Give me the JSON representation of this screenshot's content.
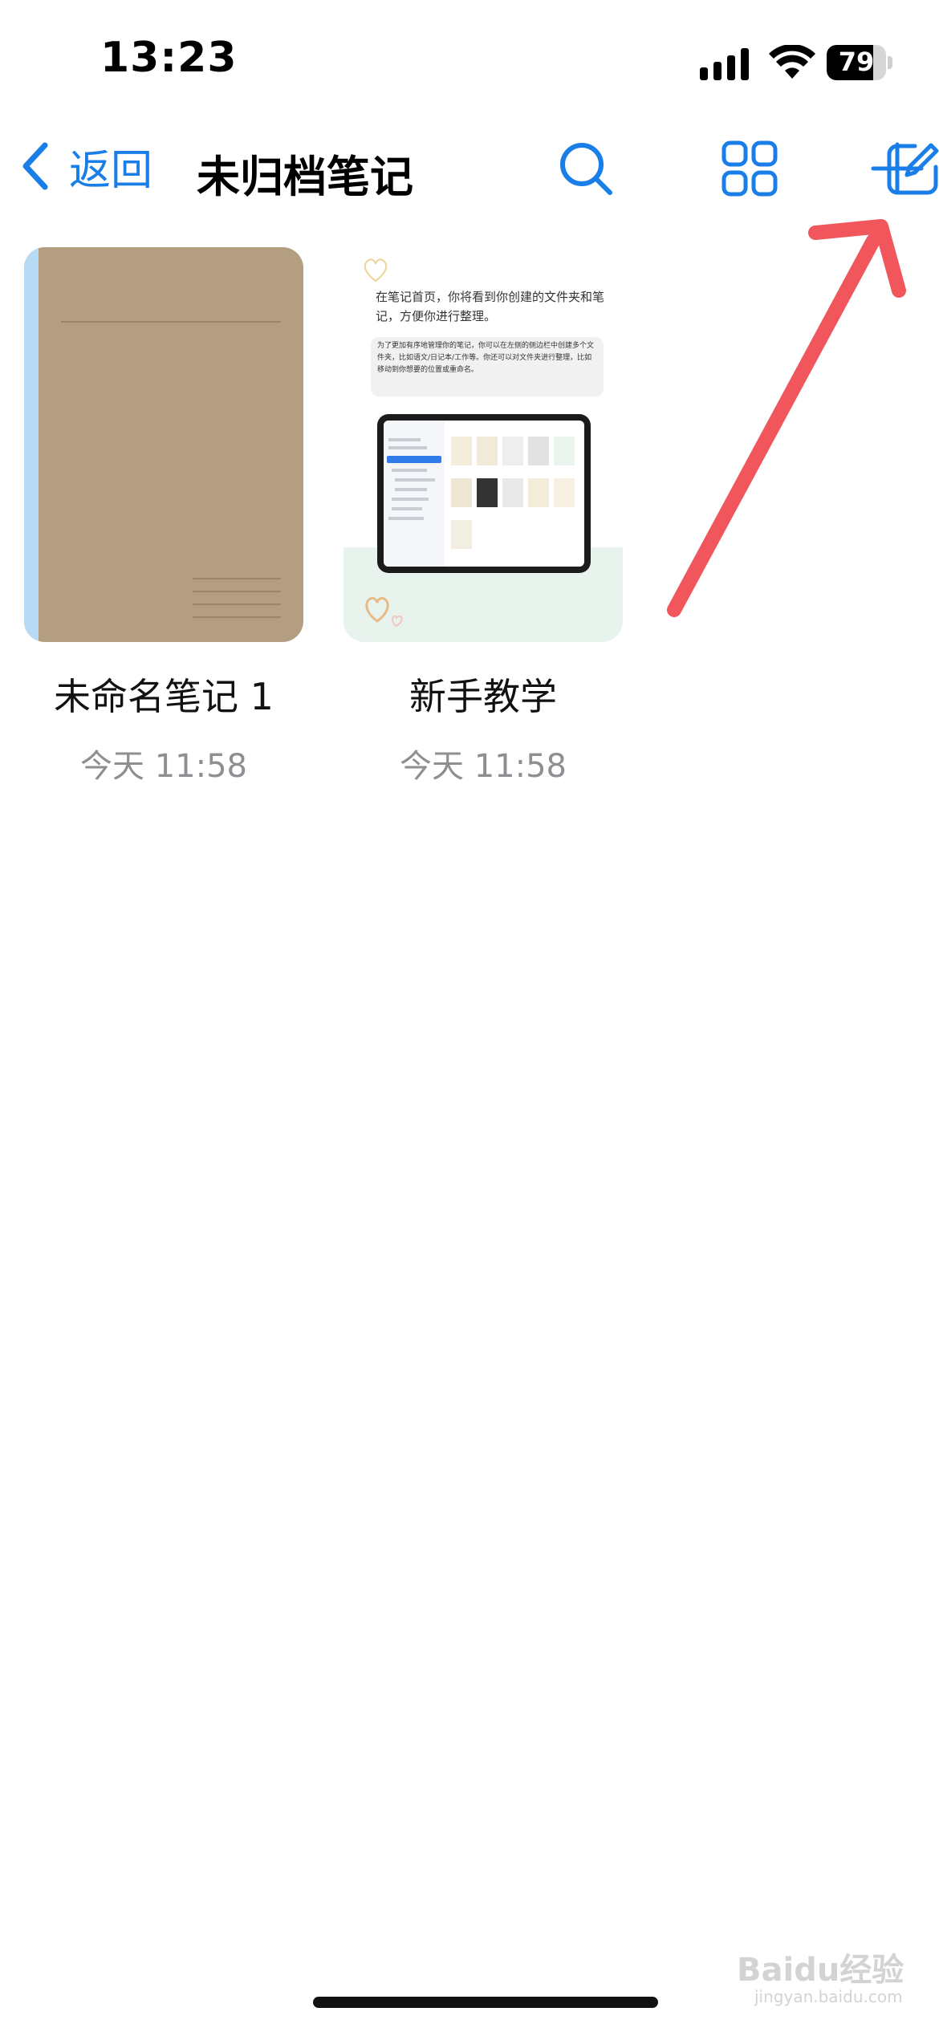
{
  "status_bar": {
    "time": "13:23",
    "battery": "79",
    "battery_level": 0.79
  },
  "nav": {
    "back_label": "返回",
    "title": "未归档笔记",
    "icons": [
      "search-icon",
      "grid-icon",
      "compose-icon",
      "add-icon"
    ]
  },
  "colors": {
    "accent": "#1a7ee8",
    "annotation_arrow": "#f0565b",
    "notebook_cover": "#b39e82",
    "notebook_spine": "#b7dbf5"
  },
  "notes": [
    {
      "title": "未命名笔记 1",
      "date": "今天 11:58"
    },
    {
      "title": "新手教学",
      "date": "今天 11:58",
      "preview_text_1": "在笔记首页，你将看到你创建的文件夹和笔记，方便你进行整理。",
      "preview_text_2": "为了更加有序地管理你的笔记，你可以在左侧的侧边栏中创建多个文件夹，比如语文/日记本/工作等。你还可以对文件夹进行整理，比如移动到你想要的位置或重命名。"
    }
  ],
  "watermark": {
    "text": "Baidu经验",
    "sub": "jingyan.baidu.com"
  }
}
